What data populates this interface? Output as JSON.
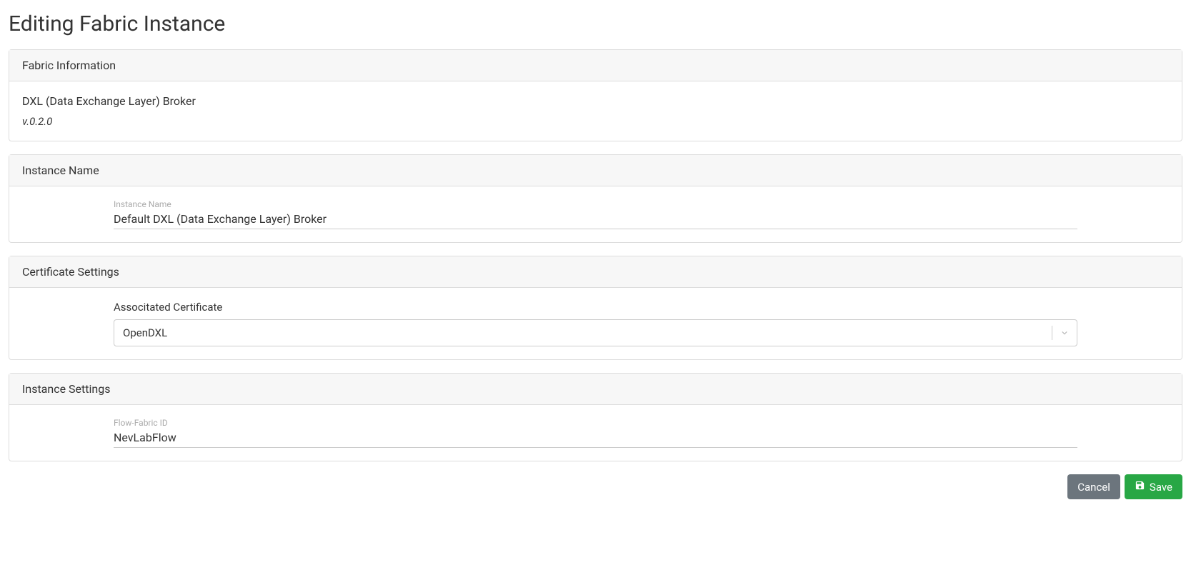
{
  "pageTitle": "Editing Fabric Instance",
  "panels": {
    "fabricInfo": {
      "header": "Fabric Information",
      "name": "DXL (Data Exchange Layer) Broker",
      "version": "v.0.2.0"
    },
    "instanceName": {
      "header": "Instance Name",
      "fieldLabel": "Instance Name",
      "value": "Default DXL (Data Exchange Layer) Broker"
    },
    "certificate": {
      "header": "Certificate Settings",
      "fieldLabel": "Associtated Certificate",
      "selected": "OpenDXL"
    },
    "instanceSettings": {
      "header": "Instance Settings",
      "fieldLabel": "Flow-Fabric ID",
      "value": "NevLabFlow"
    }
  },
  "buttons": {
    "cancel": "Cancel",
    "save": "Save"
  }
}
